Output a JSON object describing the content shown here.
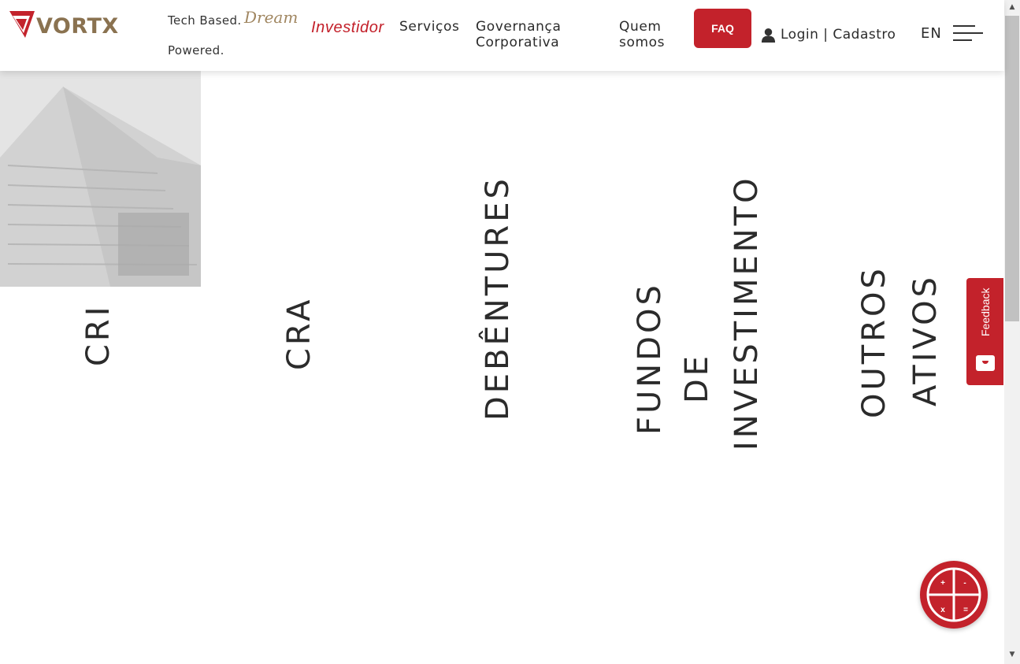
{
  "header": {
    "logo_text": "VORTX",
    "tagline_part1": "Tech Based.",
    "tagline_script": "Dream",
    "tagline_part2": "Powered.",
    "nav": {
      "investidor": "Investidor",
      "servicos": "Serviços",
      "governanca": "Governança Corporativa",
      "quem_somos": "Quem somos"
    },
    "faq_label": "FAQ",
    "login_label": "Login | Cadastro",
    "language": "EN"
  },
  "categories": [
    {
      "label": "CRI"
    },
    {
      "label": "CRA"
    },
    {
      "label": "DEBÊNTURES"
    },
    {
      "label_lines": [
        "FUNDOS",
        "DE",
        "INVESTIMENTO"
      ]
    },
    {
      "label_lines": [
        "OUTROS",
        "ATIVOS"
      ]
    }
  ],
  "feedback": {
    "label": "Feedback"
  },
  "calculator": {
    "symbols": [
      "+",
      "-",
      "x",
      "="
    ]
  },
  "colors": {
    "brand_red": "#c3222b",
    "brand_gold": "#8a7250",
    "text": "#2b2b2b"
  },
  "icons": [
    "vortx-logo-icon",
    "user-icon",
    "hamburger-menu-icon",
    "feedback-face-icon",
    "calculator-icon"
  ]
}
